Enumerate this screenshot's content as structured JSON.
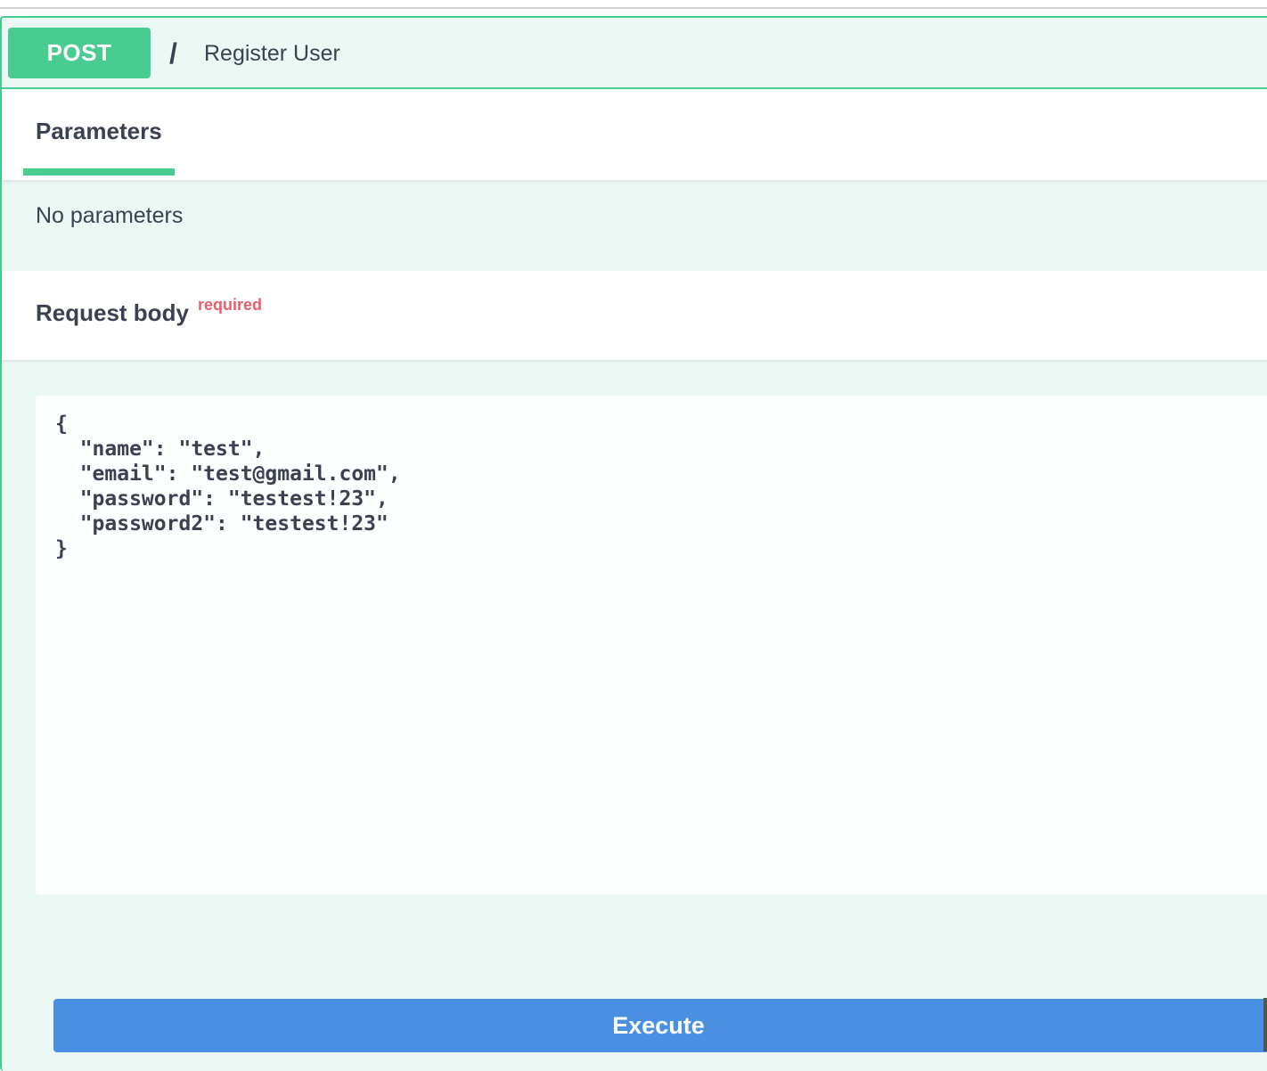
{
  "operation": {
    "method": "POST",
    "path": "/",
    "summary": "Register User",
    "colors": {
      "method_badge": "#49cc90",
      "block_background": "#ebf8f3",
      "execute_button": "#4990e2",
      "required": "#e4606d"
    }
  },
  "tabs": {
    "parameters_label": "Parameters"
  },
  "parameters": {
    "empty_text": "No parameters"
  },
  "request_body": {
    "title": "Request body",
    "required_label": "required",
    "value": "{\n  \"name\": \"test\",\n  \"email\": \"test@gmail.com\",\n  \"password\": \"testest!23\",\n  \"password2\": \"testest!23\"\n}"
  },
  "actions": {
    "execute_label": "Execute"
  }
}
